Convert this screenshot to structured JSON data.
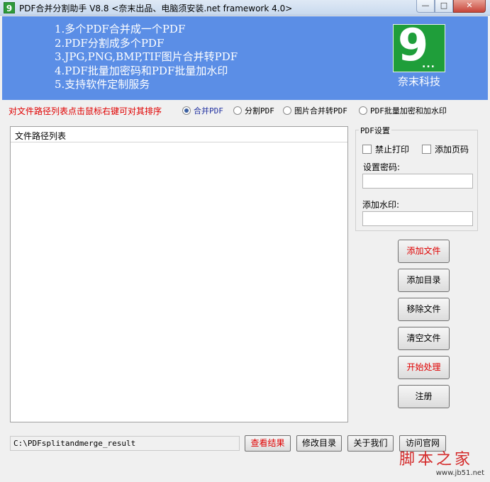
{
  "window": {
    "icon_text": "9",
    "title": "PDF合并分割助手 V8.8 <奈末出品、电脑须安装.net framework 4.0>",
    "min_glyph": "—",
    "max_glyph": "□",
    "close_glyph": "✕"
  },
  "banner": {
    "background": "#5b8ee6",
    "features": [
      "1.多个PDF合并成一个PDF",
      "2.PDF分割成多个PDF",
      "3.JPG,PNG,BMP,TIF图片合并转PDF",
      "4.PDF批量加密码和PDF批量加水印",
      "5.支持软件定制服务"
    ],
    "logo": {
      "digit": "9",
      "dots": "...",
      "caption": "奈末科技",
      "color": "#1f9e3a"
    }
  },
  "hint": "对文件路径列表点击鼠标右键可对其排序",
  "modes": [
    {
      "label": "合并PDF",
      "selected": true
    },
    {
      "label": "分割PDF",
      "selected": false
    },
    {
      "label": "图片合并转PDF",
      "selected": false
    },
    {
      "label": "PDF批量加密和加水印",
      "selected": false
    }
  ],
  "file_list": {
    "header": "文件路径列表"
  },
  "pdf_settings": {
    "title": "PDF设置",
    "disable_print": "禁止打印",
    "add_page_number": "添加页码",
    "password_label": "设置密码:",
    "password_value": "",
    "watermark_label": "添加水印:",
    "watermark_value": ""
  },
  "actions": {
    "add_file": "添加文件",
    "add_folder": "添加目录",
    "remove_file": "移除文件",
    "clear_files": "清空文件",
    "start": "开始处理",
    "register": "注册"
  },
  "bottom": {
    "output_path": "C:\\PDFsplitandmerge_result",
    "view_result": "查看结果",
    "change_dir": "修改目录",
    "about": "关于我们",
    "website": "访问官网"
  },
  "watermark": {
    "text": "脚本之家",
    "url": "www.jb51.net"
  },
  "colors": {
    "accent_red": "#e00000",
    "selected_radio_text": "#2030a0"
  }
}
